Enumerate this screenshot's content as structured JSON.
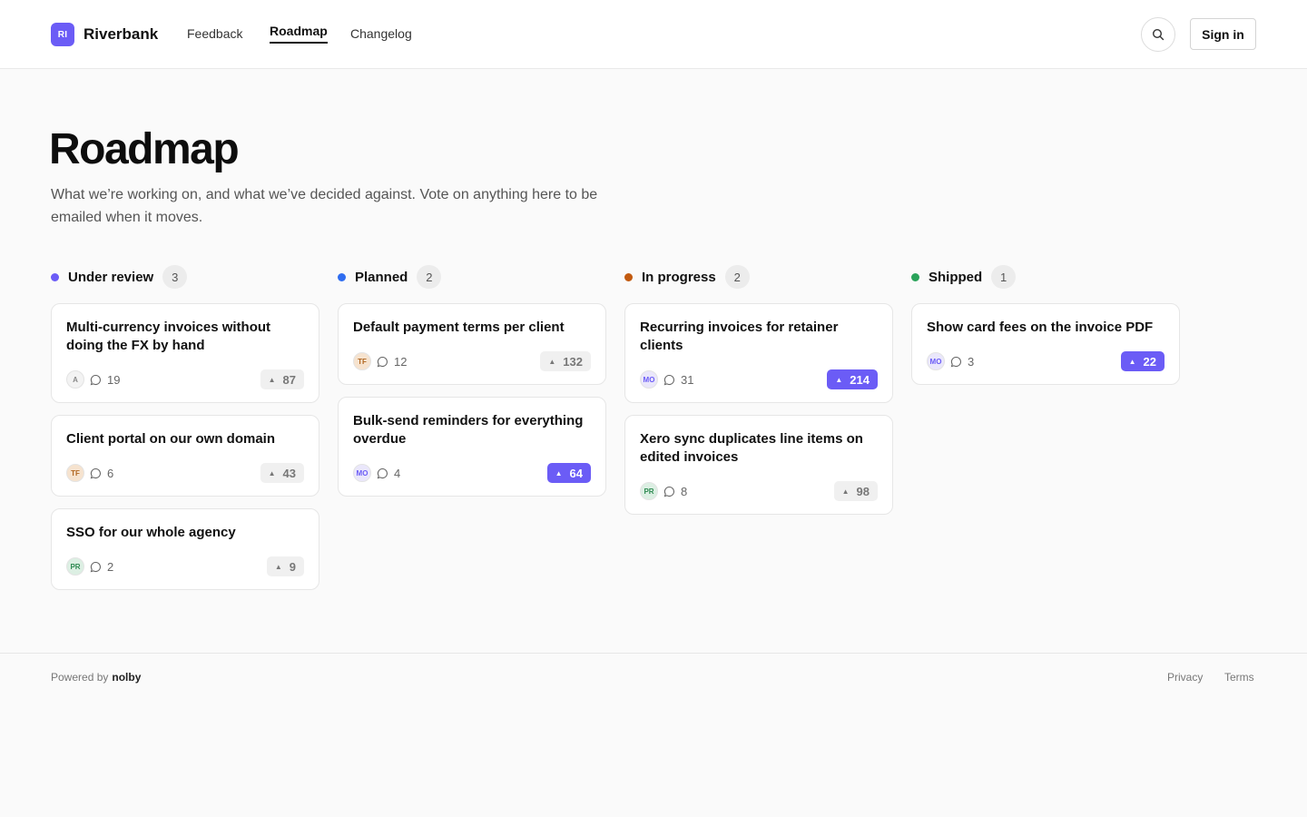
{
  "header": {
    "logo_initials": "RI",
    "brand": "Riverbank",
    "nav": [
      {
        "label": "Feedback"
      },
      {
        "label": "Roadmap"
      },
      {
        "label": "Changelog"
      }
    ],
    "signin_label": "Sign in"
  },
  "hero": {
    "title": "Roadmap",
    "description": "What we’re working on, and what we’ve decided against. Vote on anything here to be emailed when it moves."
  },
  "colors": {
    "accent": "#6b5cf6",
    "under_review": "#6b5cf6",
    "planned": "#2f6df0",
    "in_progress": "#c25a0f",
    "shipped": "#2aa35a"
  },
  "columns": [
    {
      "name": "Under review",
      "count": "3",
      "cards": [
        {
          "title": "Multi-currency invoices without doing the FX by hand",
          "avatar": "A",
          "comments": "19",
          "votes": "87",
          "voted": false
        },
        {
          "title": "Client portal on our own domain",
          "avatar": "TF",
          "comments": "6",
          "votes": "43",
          "voted": false
        },
        {
          "title": "SSO for our whole agency",
          "avatar": "PR",
          "comments": "2",
          "votes": "9",
          "voted": false
        }
      ]
    },
    {
      "name": "Planned",
      "count": "2",
      "cards": [
        {
          "title": "Default payment terms per client",
          "avatar": "TF",
          "comments": "12",
          "votes": "132",
          "voted": false
        },
        {
          "title": "Bulk-send reminders for everything overdue",
          "avatar": "MO",
          "comments": "4",
          "votes": "64",
          "voted": true
        }
      ]
    },
    {
      "name": "In progress",
      "count": "2",
      "cards": [
        {
          "title": "Recurring invoices for retainer clients",
          "avatar": "MO",
          "comments": "31",
          "votes": "214",
          "voted": true
        },
        {
          "title": "Xero sync duplicates line items on edited invoices",
          "avatar": "PR",
          "comments": "8",
          "votes": "98",
          "voted": false
        }
      ]
    },
    {
      "name": "Shipped",
      "count": "1",
      "cards": [
        {
          "title": "Show card fees on the invoice PDF",
          "avatar": "MO",
          "comments": "3",
          "votes": "22",
          "voted": true
        }
      ]
    }
  ],
  "footer": {
    "powered_by": "Powered by",
    "powered_brand": "nolby",
    "links": [
      {
        "label": "Privacy"
      },
      {
        "label": "Terms"
      }
    ]
  }
}
